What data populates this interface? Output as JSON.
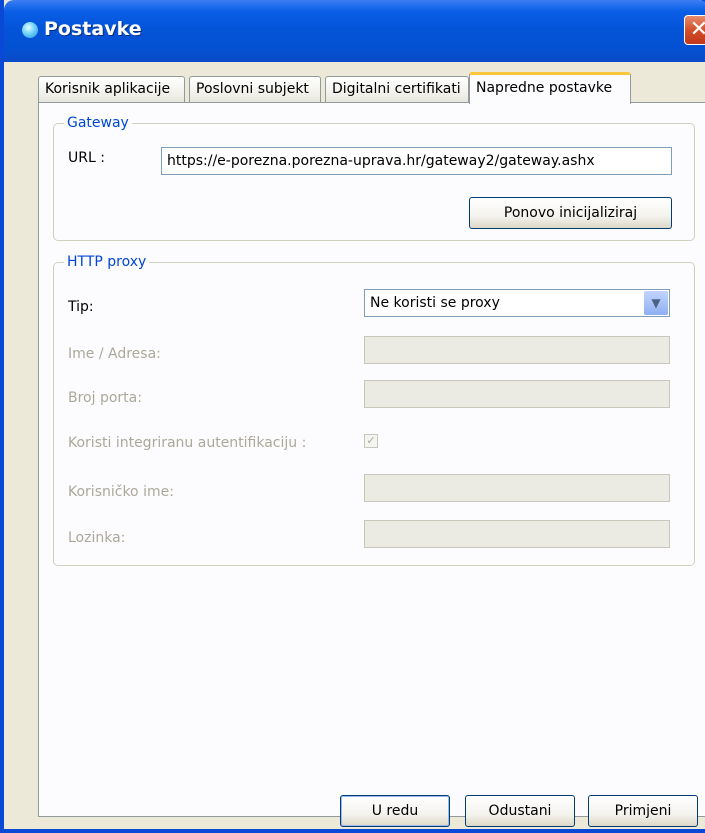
{
  "window": {
    "title": "Postavke",
    "close_glyph": "✕"
  },
  "tabs": [
    {
      "label": "Korisnik aplikacije",
      "active": false
    },
    {
      "label": "Poslovni subjekt",
      "active": false
    },
    {
      "label": "Digitalni certifikati",
      "active": false
    },
    {
      "label": "Napredne postavke",
      "active": true
    }
  ],
  "gateway": {
    "group_title": "Gateway",
    "url_label": "URL :",
    "url_value": "https://e-porezna.porezna-uprava.hr/gateway2/gateway.ashx",
    "reinit_button": "Ponovo inicijaliziraj"
  },
  "proxy": {
    "group_title": "HTTP proxy",
    "type_label": "Tip:",
    "type_value": "Ne koristi se proxy",
    "address_label": "Ime / Adresa:",
    "address_value": "",
    "port_label": "Broj porta:",
    "port_value": "",
    "integrated_auth_label": "Koristi integriranu autentifikaciju :",
    "integrated_auth_checked": true,
    "username_label": "Korisničko ime:",
    "username_value": "",
    "password_label": "Lozinka:",
    "password_value": ""
  },
  "footer": {
    "ok_button": "U redu",
    "cancel_button": "Odustani",
    "apply_button": "Primjeni"
  },
  "icons": {
    "app": "app-globe-icon",
    "close": "close-icon",
    "dropdown": "chevron-down-icon",
    "check": "checkmark-icon"
  },
  "colors": {
    "titlebar": "#0454d9",
    "group_title": "#0046d5",
    "disabled_text": "#aca899",
    "close_button": "#d4502a",
    "active_tab_accent": "#ffc83c"
  }
}
